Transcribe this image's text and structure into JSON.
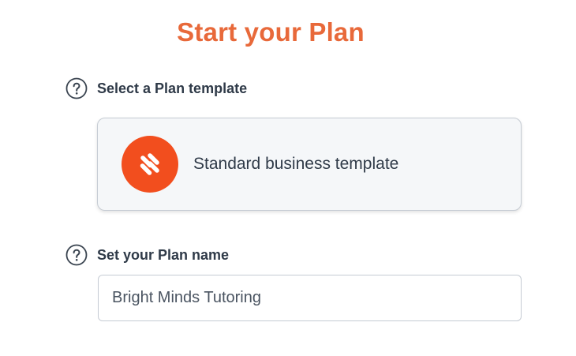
{
  "page": {
    "title": "Start your Plan"
  },
  "template_section": {
    "label": "Select a Plan template",
    "help_icon": "question-circle-icon",
    "selected_template": {
      "name": "Standard business template",
      "logo_icon": "plan-logo-icon",
      "logo_color": "#f24e1e"
    }
  },
  "name_section": {
    "label": "Set your Plan name",
    "help_icon": "question-circle-icon",
    "input_value": "Bright Minds Tutoring"
  },
  "colors": {
    "title": "#e8693a",
    "text": "#2f3a48",
    "border": "#c5cbd3",
    "card_background": "#f5f7f9"
  }
}
